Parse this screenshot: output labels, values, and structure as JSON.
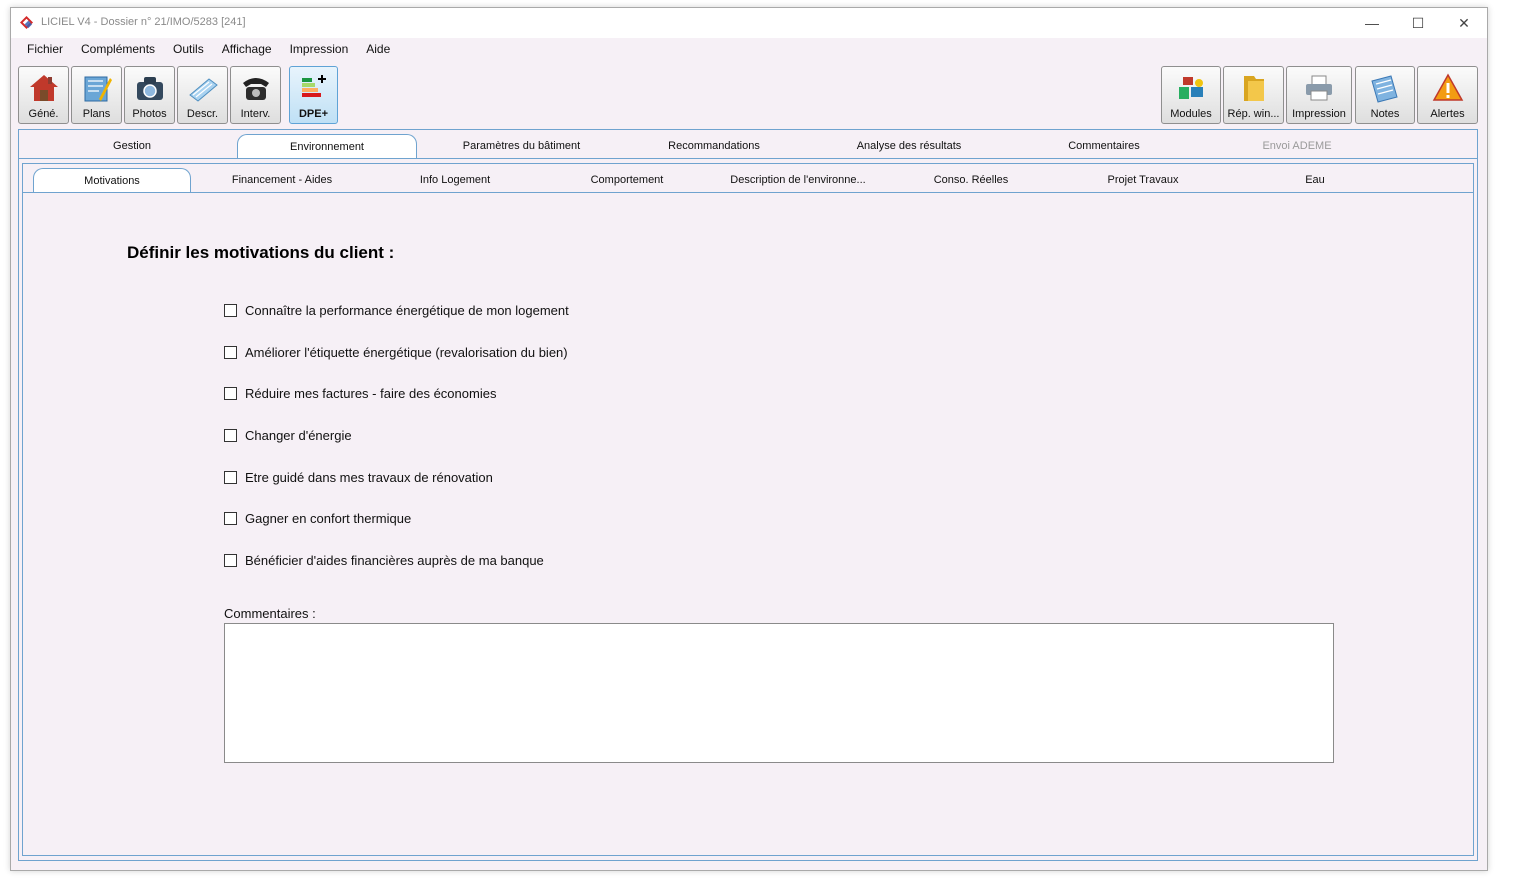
{
  "window": {
    "title": "LICIEL V4 - Dossier n° 21/IMO/5283 [241]",
    "controls": {
      "minimize": "—",
      "maximize": "☐",
      "close": "✕"
    }
  },
  "menu": [
    "Fichier",
    "Compléments",
    "Outils",
    "Affichage",
    "Impression",
    "Aide"
  ],
  "toolbar_left": [
    {
      "label": "Géné.",
      "icon": "house-icon"
    },
    {
      "label": "Plans",
      "icon": "plans-icon"
    },
    {
      "label": "Photos",
      "icon": "camera-icon"
    },
    {
      "label": "Descr.",
      "icon": "description-icon"
    },
    {
      "label": "Interv.",
      "icon": "phone-icon"
    },
    {
      "label": "DPE+",
      "icon": "energy-label-icon",
      "active": true
    }
  ],
  "toolbar_right": [
    {
      "label": "Modules",
      "icon": "puzzle-icon"
    },
    {
      "label": "Rép. win...",
      "icon": "folder-icon"
    },
    {
      "label": "Impression",
      "icon": "printer-icon"
    },
    {
      "label": "Notes",
      "icon": "notes-icon"
    },
    {
      "label": "Alertes",
      "icon": "warning-icon"
    }
  ],
  "main_tabs": [
    {
      "label": "Gestion"
    },
    {
      "label": "Environnement",
      "selected": true
    },
    {
      "label": "Paramètres du bâtiment"
    },
    {
      "label": "Recommandations"
    },
    {
      "label": "Analyse des résultats"
    },
    {
      "label": "Commentaires"
    },
    {
      "label": "Envoi ADEME",
      "disabled": true
    }
  ],
  "sub_tabs": [
    {
      "label": "Motivations",
      "selected": true
    },
    {
      "label": "Financement  - Aides"
    },
    {
      "label": "Info Logement"
    },
    {
      "label": "Comportement"
    },
    {
      "label": "Description de l'environne..."
    },
    {
      "label": "Conso. Réelles"
    },
    {
      "label": "Projet Travaux"
    },
    {
      "label": "Eau"
    }
  ],
  "form": {
    "heading": "Définir les motivations du client :",
    "options": [
      {
        "label": "Connaître la performance énergétique de mon logement",
        "checked": false
      },
      {
        "label": "Améliorer l'étiquette énergétique (revalorisation du bien)",
        "checked": false
      },
      {
        "label": "Réduire mes factures - faire des économies",
        "checked": false
      },
      {
        "label": "Changer d'énergie",
        "checked": false
      },
      {
        "label": "Etre guidé dans mes travaux de rénovation",
        "checked": false
      },
      {
        "label": "Gagner en confort thermique",
        "checked": false
      },
      {
        "label": "Bénéficier d'aides financières auprès de ma banque",
        "checked": false
      }
    ],
    "comments_label": "Commentaires :",
    "comments_value": ""
  }
}
